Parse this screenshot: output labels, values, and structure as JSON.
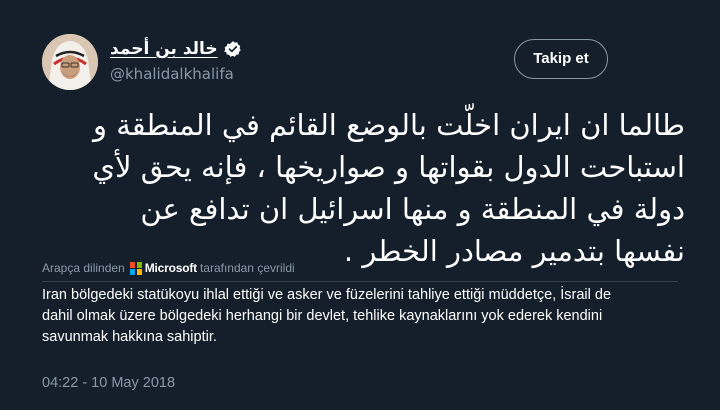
{
  "author": {
    "display_name": "خالد بن أحمد",
    "username": "@khalidalkhalifa",
    "verified": true,
    "verified_icon": "verified-badge-icon"
  },
  "follow_button": {
    "label": "Takip et"
  },
  "tweet": {
    "text_lines": [
      "طالما ان ايران اخلّت بالوضع القائم في المنطقة و",
      "استباحت الدول بقواتها و صواريخها ، فإنه يحق لأي",
      "دولة في المنطقة و منها اسرائيل ان تدافع عن",
      "نفسها بتدمير مصادر الخطر ."
    ]
  },
  "translation": {
    "prefix": "Arapça dilinden",
    "provider": "Microsoft",
    "suffix": "tarafından çevrildi",
    "lines": [
      "Iran bölgedeki statükoyu ihlal ettiği ve asker ve füzelerini tahliye ettiği müddetçe, İsrail de",
      "dahil olmak üzere bölgedeki herhangi bir devlet, tehlike kaynaklarını yok ederek kendini",
      "savunmak hakkına sahiptir."
    ]
  },
  "timestamp": "04:22 - 10 May 2018",
  "colors": {
    "background": "#151f2b",
    "secondary_text": "#8899a6",
    "primary_text": "#ffffff",
    "accent_blue": "#1da1f2",
    "divider": "#38444d"
  }
}
